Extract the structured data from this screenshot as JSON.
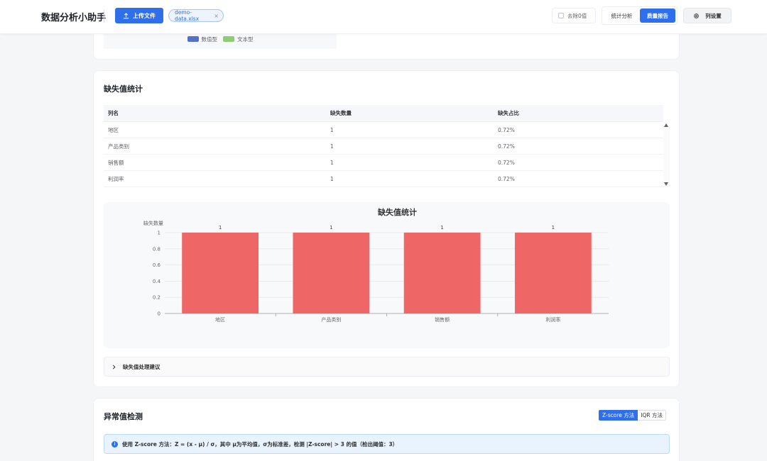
{
  "header": {
    "app_title": "数据分析小助手",
    "upload_label": "上传文件",
    "file_name": "demo-data.xlsx",
    "file_close": "×",
    "zero_toggle_label": "去除0值",
    "view_stat_label": "统计分析",
    "view_quality_label": "质量报告",
    "col_settings_label": "列设置"
  },
  "top_card": {
    "legend": [
      {
        "label": "数值型",
        "color": "#5470c6"
      },
      {
        "label": "文本型",
        "color": "#91cc75"
      }
    ]
  },
  "missing": {
    "title": "缺失值统计",
    "table": {
      "headers": [
        "列名",
        "缺失数量",
        "缺失占比"
      ],
      "rows": [
        [
          "地区",
          "1",
          "0.72%"
        ],
        [
          "产品类别",
          "1",
          "0.72%"
        ],
        [
          "销售额",
          "1",
          "0.72%"
        ],
        [
          "利润率",
          "1",
          "0.72%"
        ]
      ]
    },
    "advice_label": "缺失值处理建议"
  },
  "chart_data": {
    "type": "bar",
    "title": "缺失值统计",
    "ylabel": "缺失数量",
    "xlabel": "",
    "categories": [
      "地区",
      "产品类别",
      "销售额",
      "利润率"
    ],
    "values": [
      1,
      1,
      1,
      1
    ],
    "ylim": [
      0,
      1
    ],
    "yticks": [
      0,
      0.2,
      0.4,
      0.6,
      0.8,
      1
    ],
    "ytick_labels": [
      "0",
      "0.2",
      "0.4",
      "0.6",
      "0.8",
      "1"
    ],
    "data_labels": [
      "1",
      "1",
      "1",
      "1"
    ],
    "bar_color": "#ee6666",
    "grid": true
  },
  "outlier": {
    "title": "异常值检测",
    "method_zscore": "Z-score 方法",
    "method_iqr": "IQR 方法",
    "info_text": "使用 Z-score 方法：Z = (x - μ) / σ，其中 μ为平均值，σ为标准差，检测 |Z-score| > 3 的值（检出阈值：3）"
  },
  "colors": {
    "primary": "#2f6fec",
    "bar": "#ee6666"
  }
}
